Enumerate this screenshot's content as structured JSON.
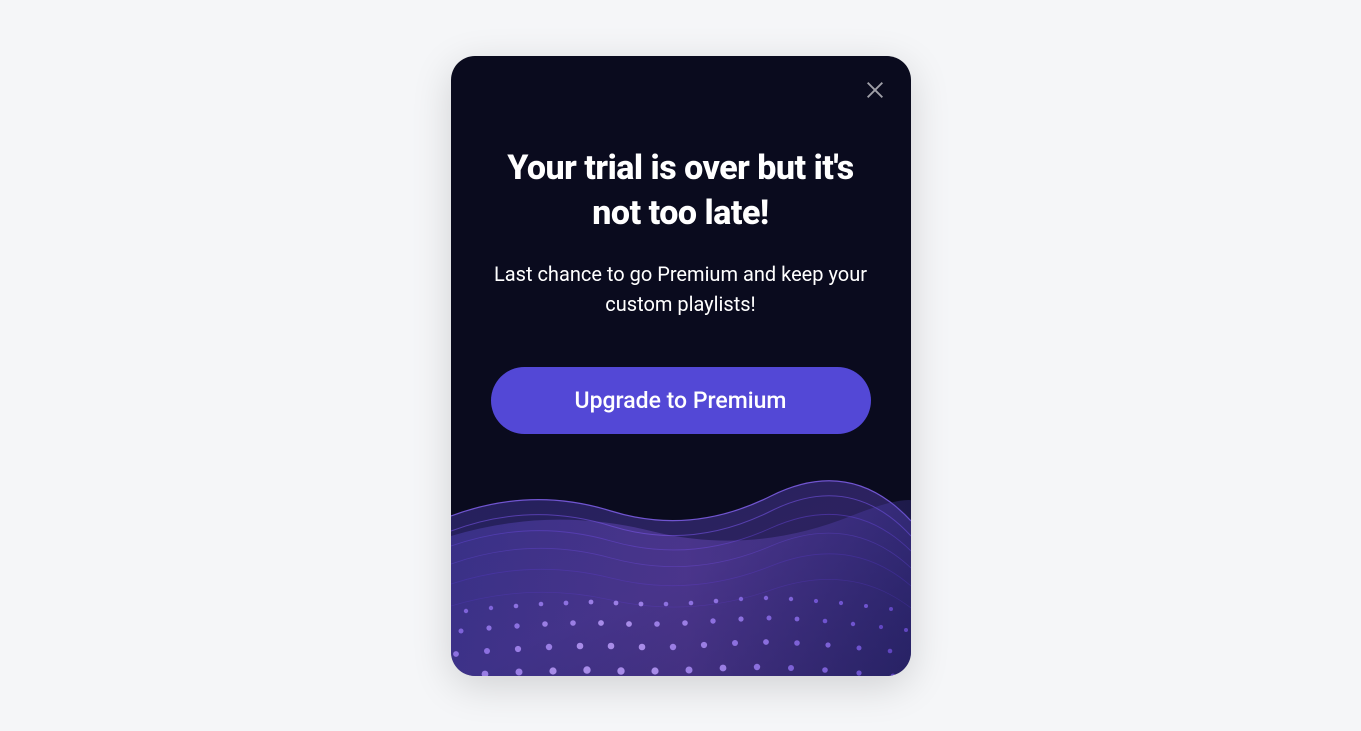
{
  "modal": {
    "title": "Your trial is over but it's not too late!",
    "subtitle": "Last chance to go Premium and keep your custom playlists!",
    "cta_label": "Upgrade to Premium",
    "colors": {
      "background": "#0a0b1e",
      "button": "#5348d6",
      "text": "#ffffff"
    }
  }
}
